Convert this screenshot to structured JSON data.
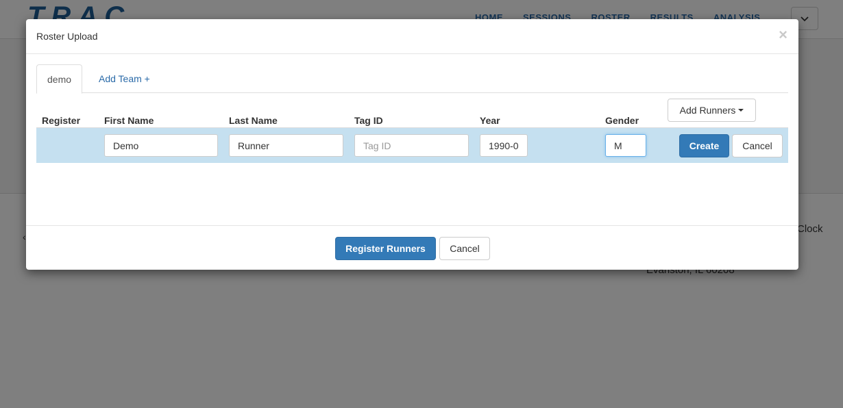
{
  "background": {
    "logo": "TRAC",
    "nav_links": [
      "HOME",
      "SESSIONS",
      "ROSTER",
      "RESULTS",
      "ANALYSIS"
    ],
    "clock_text": "Clock",
    "address_text": "Evanston, IL 60208",
    "arrow_text": "‹"
  },
  "modal": {
    "title": "Roster Upload",
    "close_icon": "×",
    "tabs": [
      {
        "label": "demo",
        "active": true
      },
      {
        "label": "Add Team +",
        "active": false
      }
    ],
    "columns": {
      "register": "Register",
      "first_name": "First Name",
      "last_name": "Last Name",
      "tag_id": "Tag ID",
      "year": "Year",
      "gender": "Gender"
    },
    "add_runners_label": "Add Runners",
    "new_runner": {
      "first_name": "Demo",
      "last_name": "Runner",
      "tag_id_value": "",
      "tag_id_placeholder": "Tag ID",
      "year": "1990-0",
      "gender": "M"
    },
    "row_buttons": {
      "create": "Create",
      "cancel": "Cancel"
    },
    "footer": {
      "register_label": "Register Runners",
      "cancel_label": "Cancel"
    }
  }
}
